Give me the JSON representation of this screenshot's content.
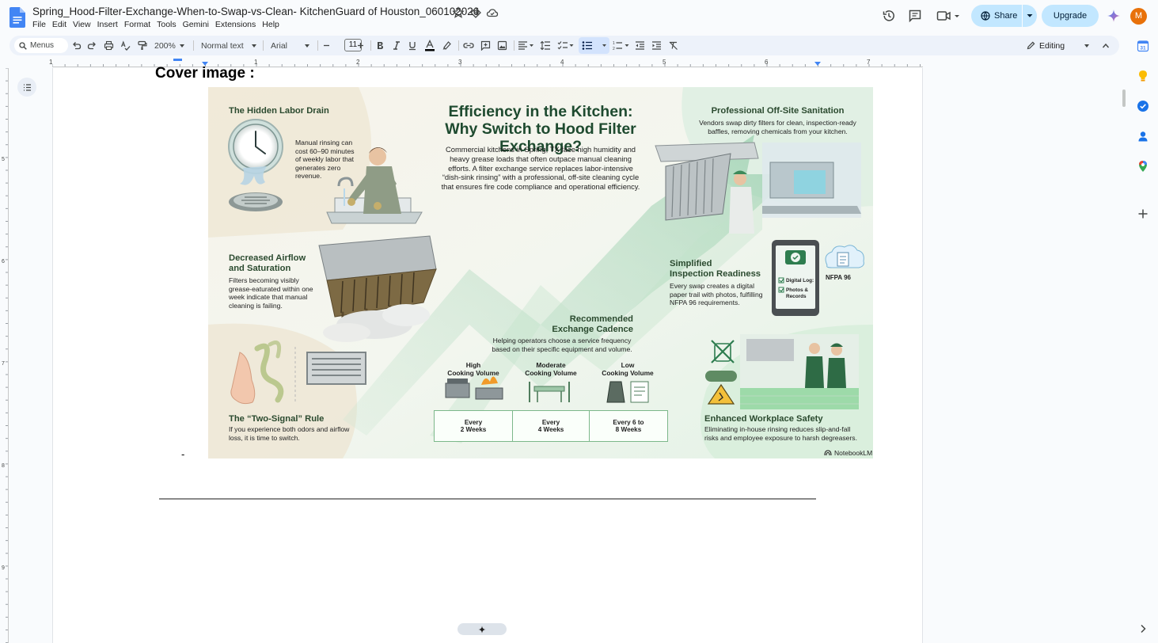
{
  "doc": {
    "title": "Spring_Hood-Filter-Exchange-When-to-Swap-vs-Clean- KitchenGuard of Houston_060102026",
    "menus": [
      "File",
      "Edit",
      "View",
      "Insert",
      "Format",
      "Tools",
      "Gemini",
      "Extensions",
      "Help"
    ]
  },
  "header": {
    "share_label": "Share",
    "upgrade_label": "Upgrade",
    "avatar_initial": "M"
  },
  "toolbar": {
    "search_label": "Menus",
    "zoom": "200%",
    "style": "Normal text",
    "font": "Arial",
    "font_size": "11",
    "mode": "Editing"
  },
  "ruler": {
    "h_numbers": [
      "1",
      "1",
      "2",
      "3",
      "4",
      "5",
      "6",
      "7"
    ],
    "v_numbers": [
      "5",
      "6",
      "7",
      "8",
      "9"
    ]
  },
  "content": {
    "cover_heading": "Cover image :",
    "stray_mark": "-"
  },
  "infographic": {
    "title_line1": "Efficiency in the Kitchen:",
    "title_line2": "Why Switch to Hood Filter Exchange?",
    "intro": "Commercial kitchens in Spring, TX face high humidity and heavy grease loads that often outpace manual cleaning efforts. A filter exchange service replaces labor-intensive “dish-sink rinsing” with a professional, off-site cleaning cycle that ensures fire code compliance and operational efficiency.",
    "hidden_labor": {
      "heading": "The Hidden Labor Drain",
      "text": "Manual rinsing can cost 60–90 minutes of weekly labor that generates zero revenue."
    },
    "airflow": {
      "heading_line1": "Decreased Airflow",
      "heading_line2": "and Saturation",
      "text": "Filters becoming visibly grease-eaturated within one week indicate that manual cleaning is failing."
    },
    "two_signal": {
      "heading": "The “Two-Signal” Rule",
      "text": "If you experience both odors and airflow loss, it is time to switch."
    },
    "sanitation": {
      "heading": "Professional Off-Site Sanitation",
      "text": "Vendors swap dirty filters for clean, inspection-ready baffles, removing chemicals from your kitchen."
    },
    "inspection": {
      "heading_line1": "Simplified",
      "heading_line2": "Inspection Readiness",
      "text": "Every swap creates a digital paper trail with photos, fulfilling NFPA 96 requirements.",
      "tablet_line1": "Digital Log:",
      "tablet_line2": "Photos &",
      "tablet_line3": "Records",
      "nfpa": "NFPA 96"
    },
    "cadence": {
      "heading_line1": "Recommended",
      "heading_line2": "Exchange Cadence",
      "text": "Helping operators choose a service frequency based on their specific equipment and volume.",
      "levels": [
        {
          "label1": "High",
          "label2": "Cooking Volume",
          "freq1": "Every",
          "freq2": "2 Weeks"
        },
        {
          "label1": "Moderate",
          "label2": "Cooking Volume",
          "freq1": "Every",
          "freq2": "4 Weeks"
        },
        {
          "label1": "Low",
          "label2": "Cooking Volume",
          "freq1": "Every 6 to",
          "freq2": "8 Weeks"
        }
      ]
    },
    "safety": {
      "heading": "Enhanced Workplace Safety",
      "text": "Eliminating in-house rinsing reduces slip-and-fall risks and employee exposure to harsh degreasers."
    },
    "brand": "NotebookLM",
    "colors": {
      "accent": "#1e4a2f",
      "mint": "#e7f3e8",
      "box_border": "#7cb88a"
    }
  }
}
